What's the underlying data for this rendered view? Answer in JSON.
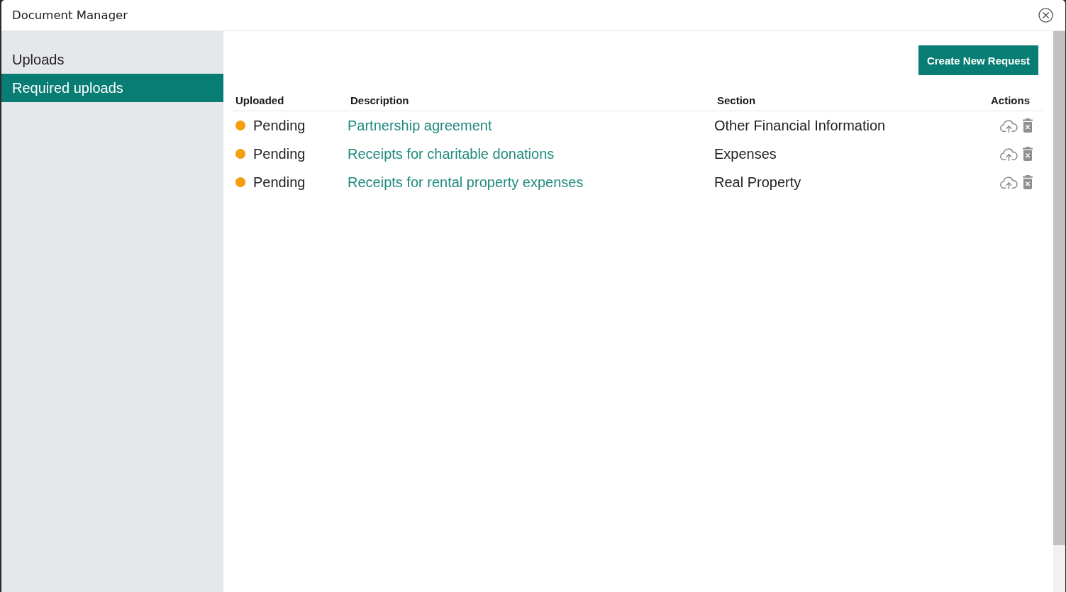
{
  "window": {
    "title": "Document Manager"
  },
  "sidebar": {
    "items": [
      {
        "label": "Uploads",
        "selected": false
      },
      {
        "label": "Required uploads",
        "selected": true
      }
    ]
  },
  "toolbar": {
    "button": "Create New Request"
  },
  "table": {
    "columns": [
      "Uploaded",
      "Description",
      "Section",
      "Actions"
    ],
    "rows": [
      {
        "status": "Pending",
        "color": "#f59e0b",
        "description": "Partnership agreement",
        "section": "Other Financial Information"
      },
      {
        "status": "Pending",
        "color": "#f59e0b",
        "description": "Receipts for charitable donations",
        "section": "Expenses"
      },
      {
        "status": "Pending",
        "color": "#f59e0b",
        "description": "Receipts for rental property expenses",
        "section": "Real Property"
      }
    ]
  }
}
